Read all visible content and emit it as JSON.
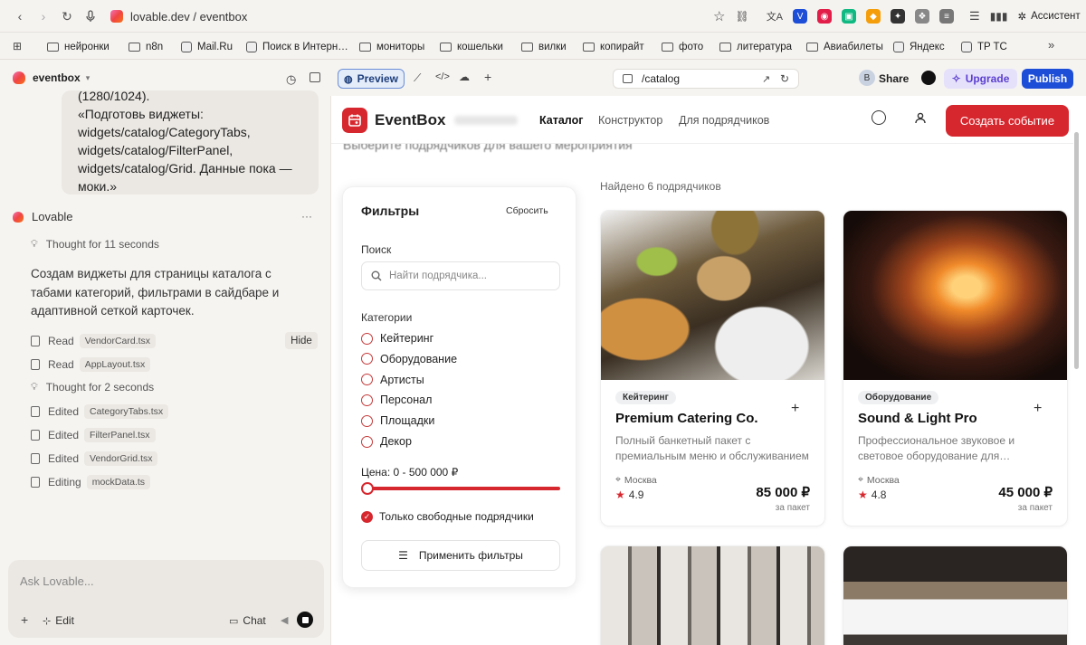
{
  "browser": {
    "url": "lovable.dev / eventbox",
    "bookmarks": [
      "нейронки",
      "n8n",
      "Mail.Ru",
      "Поиск в Интерн…",
      "мониторы",
      "кошельки",
      "вилки",
      "копирайт",
      "фото",
      "литература",
      "Авиабилеты",
      "Яндекс",
      "TP TC"
    ],
    "assistant_label": "Ассистент"
  },
  "project": {
    "name": "eventbox"
  },
  "chat": {
    "user_message_lines": [
      "(1280/1024).",
      "«Подготовь виджеты:",
      "widgets/catalog/CategoryTabs,",
      "widgets/catalog/FilterPanel,",
      "widgets/catalog/Grid. Данные пока —",
      "моки.»"
    ],
    "assistant_name": "Lovable",
    "thought1": "Thought for 11 seconds",
    "reply": "Создам виджеты для страницы каталога с табами категорий, фильтрами в сайдбаре и адаптивной сеткой карточек.",
    "hide_label": "Hide",
    "steps": [
      {
        "verb": "Read",
        "file": "VendorCard.tsx"
      },
      {
        "verb": "Read",
        "file": "AppLayout.tsx"
      },
      {
        "verb": "Thought for 2 seconds",
        "file": ""
      },
      {
        "verb": "Edited",
        "file": "CategoryTabs.tsx"
      },
      {
        "verb": "Edited",
        "file": "FilterPanel.tsx"
      },
      {
        "verb": "Edited",
        "file": "VendorGrid.tsx"
      },
      {
        "verb": "Editing",
        "file": "mockData.ts"
      }
    ],
    "input_placeholder": "Ask Lovable...",
    "edit_label": "Edit",
    "chat_label": "Chat"
  },
  "workspace": {
    "preview_label": "Preview",
    "path": "/catalog",
    "share_label": "Share",
    "upgrade_label": "Upgrade",
    "publish_label": "Publish",
    "avatar_letter": "B"
  },
  "app": {
    "brand": "EventBox",
    "nav": [
      "Каталог",
      "Конструктор",
      "Для подрядчиков"
    ],
    "create_label": "Создать событие",
    "subtitle": "Выберите подрядчиков для вашего мероприятия",
    "found_text": "Найдено 6 подрядчиков",
    "filters": {
      "title": "Фильтры",
      "reset": "Сбросить",
      "search_label": "Поиск",
      "search_placeholder": "Найти подрядчика...",
      "categories_label": "Категории",
      "categories": [
        "Кейтеринг",
        "Оборудование",
        "Артисты",
        "Персонал",
        "Площадки",
        "Декор"
      ],
      "price_label": "Цена: 0 - 500 000 ₽",
      "only_free_label": "Только свободные подрядчики",
      "apply_label": "Применить фильтры"
    },
    "cards": [
      {
        "badge": "Кейтеринг",
        "title": "Premium Catering Co.",
        "desc": "Полный банкетный пакет с премиальным меню и обслуживанием",
        "city": "Москва",
        "rating": "4.9",
        "price": "85 000 ₽",
        "per": "за пакет"
      },
      {
        "badge": "Оборудование",
        "title": "Sound & Light Pro",
        "desc": "Профессиональное звуковое и световое оборудование для…",
        "city": "Москва",
        "rating": "4.8",
        "price": "45 000 ₽",
        "per": "за пакет"
      }
    ]
  },
  "colors": {
    "accent": "#d7272e",
    "publish": "#1d4ed8",
    "upgrade": "#e6e1fb"
  }
}
